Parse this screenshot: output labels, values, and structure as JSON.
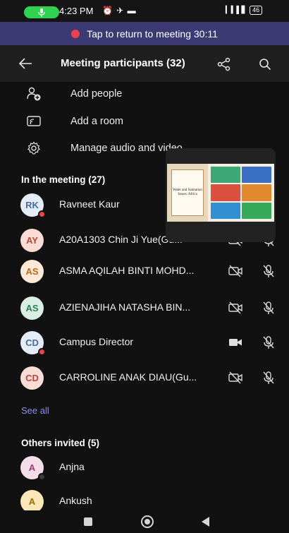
{
  "status_bar": {
    "time": "4:23 PM",
    "icons": "⏰ ✈ ▬",
    "network": "▎▍▌▋",
    "battery": "46"
  },
  "banner": {
    "text": "Tap to return to meeting 30:11"
  },
  "header": {
    "title": "Meeting participants (32)"
  },
  "actions": [
    {
      "label": "Add people"
    },
    {
      "label": "Add a room"
    },
    {
      "label": "Manage audio and video"
    }
  ],
  "in_meeting": {
    "title": "In the meeting (27)",
    "participants": [
      {
        "initials": "RK",
        "name": "Ravneet Kaur",
        "avatar_bg": "#e3ecf7",
        "avatar_fg": "#4b6b96",
        "badge": true
      },
      {
        "initials": "AY",
        "name": "A20A1303 Chin Ji Yue(Gu...",
        "avatar_bg": "#f9dcd5",
        "avatar_fg": "#b5483a",
        "badge": false
      },
      {
        "initials": "AS",
        "name": "ASMA AQILAH BINTI MOHD...",
        "avatar_bg": "#fde9d6",
        "avatar_fg": "#b66a22",
        "badge": false
      },
      {
        "initials": "AS",
        "name": "AZIENAJIHA NATASHA BIN...",
        "avatar_bg": "#d9efe4",
        "avatar_fg": "#2e7d55",
        "badge": false
      },
      {
        "initials": "CD",
        "name": "Campus Director",
        "avatar_bg": "#e3ecf7",
        "avatar_fg": "#4b6b96",
        "badge": true
      },
      {
        "initials": "CD",
        "name": "CARROLINE ANAK DIAU(Gu...",
        "avatar_bg": "#f9dcd5",
        "avatar_fg": "#b5483a",
        "badge": false
      }
    ],
    "see_all": "See all"
  },
  "others_invited": {
    "title": "Others invited (5)",
    "participants": [
      {
        "initials": "A",
        "name": "Anjna",
        "avatar_bg": "#f3dde9",
        "avatar_fg": "#9b3f70"
      },
      {
        "initials": "A",
        "name": "Ankush",
        "avatar_bg": "#fbe7b8",
        "avatar_fg": "#9a6a0b"
      }
    ]
  },
  "video_overlay": {
    "slide_title": "Water and Sanitation Issues: Africa"
  },
  "colors": {
    "banner_bg": "#3d3a73",
    "accent": "#8d8ff0",
    "alert_red": "#e8434f",
    "call_green": "#2fd34f"
  }
}
